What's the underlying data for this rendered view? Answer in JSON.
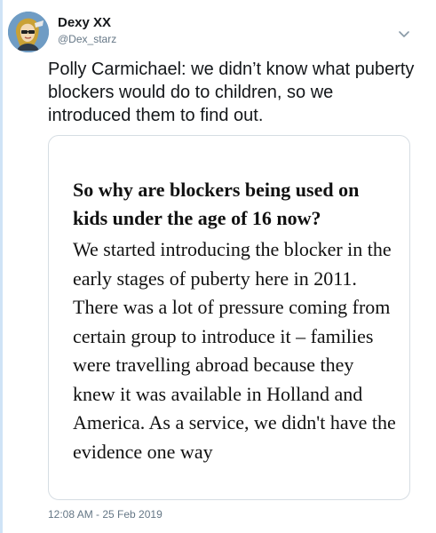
{
  "author": {
    "display_name": "Dexy XX",
    "handle": "@Dex_starz"
  },
  "tweet": {
    "text": "Polly Carmichael: we didn’t know what puberty blockers would do to children, so we introduced them to find out."
  },
  "card": {
    "heading": "So why are blockers being used on kids under the age of 16 now?",
    "body": "We started introducing the blocker in the early stages of puberty here in 2011. There was a lot of pressure coming from certain group to introduce it – families were travelling abroad because they knew it was available in Holland and America. As a service, we didn't have the evidence one way"
  },
  "timestamp": "12:08 AM - 25 Feb 2019",
  "icons": {
    "avatar": "cartoon-avatar",
    "menu": "chevron-down-icon"
  },
  "colors": {
    "thread_line": "#cfe3f6",
    "muted_text": "#657786",
    "card_border": "#d6dde3"
  }
}
